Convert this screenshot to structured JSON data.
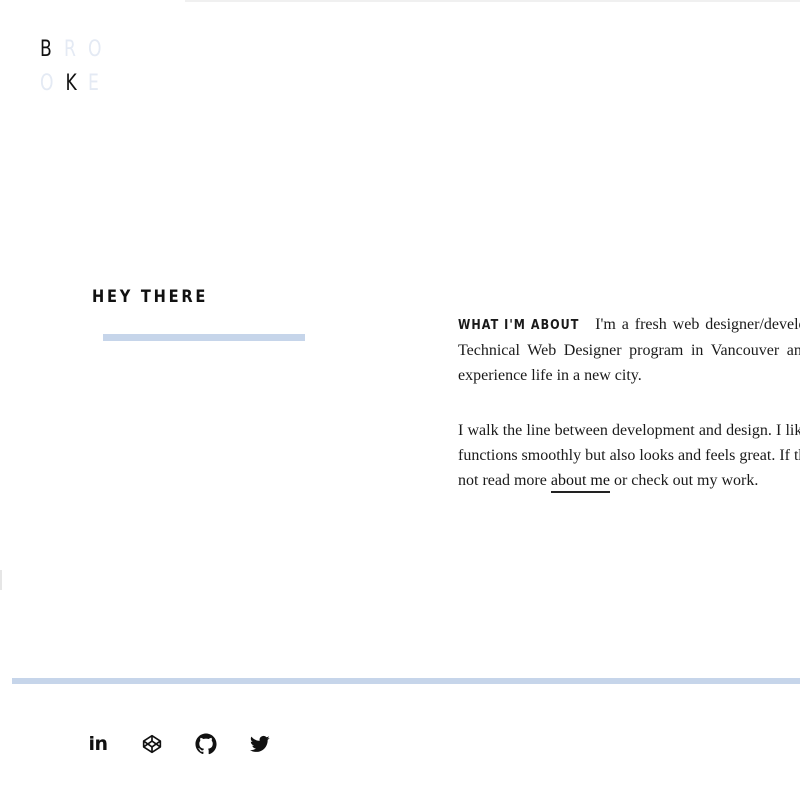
{
  "logo": {
    "letters": [
      "B",
      "R",
      "O",
      "O",
      "K",
      "E"
    ]
  },
  "intro": {
    "heading": "HEY THERE",
    "kicker": "WHAT I'M ABOUT",
    "paragraph1": " I'm a fresh web designer/developer who graduated from BCIT's Technical Web Designer program in Vancouver and recently moved to Toronto to experience life in a new city.",
    "paragraph2_text": "I walk the line between development and design. I like to create a product that not only functions smoothly but also looks and feels great. If that sounds interesting to you, why not read more ",
    "about_link": "about me",
    "paragraph2_tail": " or check out my work."
  },
  "social": {
    "items": [
      {
        "name": "linkedin-icon",
        "label": "in"
      },
      {
        "name": "codepen-icon"
      },
      {
        "name": "github-icon"
      },
      {
        "name": "twitter-icon"
      }
    ]
  },
  "colors": {
    "accent": "#c6d5ea",
    "logo_faint": "#e4eaf4",
    "text": "#111111"
  }
}
